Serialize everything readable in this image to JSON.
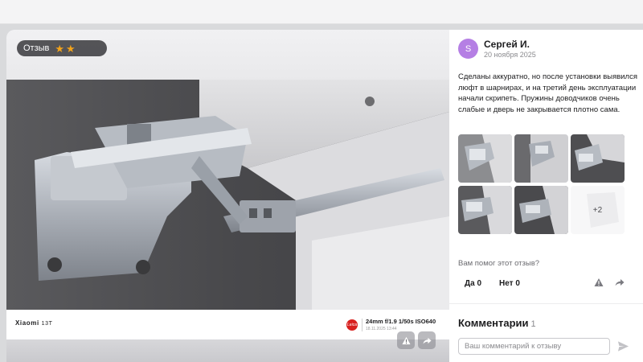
{
  "viewer": {
    "badge_label": "Отзыв",
    "rating": 2,
    "exif": {
      "model": "Xiaomi",
      "model_sub": "13T",
      "brand_badge": "Leica",
      "params": "24mm  f/1.9  1/50s  ISO640",
      "date": "18.11.2025 13:44"
    },
    "actions": {
      "report_icon": "warning-icon",
      "share_icon": "share-arrow-icon"
    }
  },
  "review": {
    "avatar_letter": "S",
    "author": "Сергей И.",
    "date": "20 ноября 2025",
    "text": "Сделаны аккуратно, но после установки выявился люфт в шарнирах, и на третий день эксплуатации начали скрипеть. Пружины доводчиков очень слабые и дверь не закрывается плотно сама.",
    "thumbnails_more": "+2"
  },
  "helpful": {
    "question": "Вам помог этот отзыв?",
    "yes_label": "Да 0",
    "no_label": "Нет 0",
    "report_icon": "warning-icon",
    "share_icon": "share-arrow-icon"
  },
  "comments": {
    "title": "Комментарии",
    "count": "1",
    "input_placeholder": "Ваш комментарий к отзыву",
    "send_icon": "send-icon"
  },
  "colors": {
    "avatar": "#b57fe4",
    "star": "#f2a31b",
    "leica": "#d8201f"
  }
}
